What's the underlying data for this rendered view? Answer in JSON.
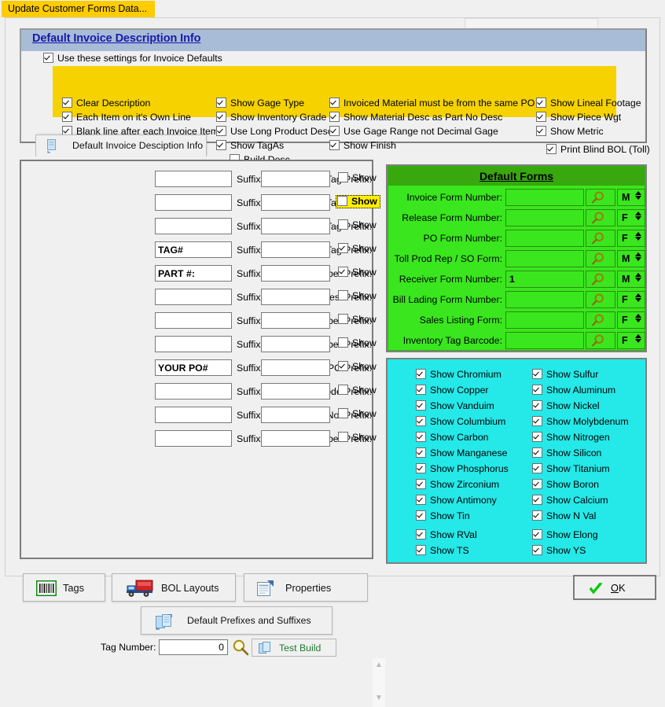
{
  "status_tab": {
    "label": "Update Customer Forms Data..."
  },
  "invoice_group": {
    "title": "Default Invoice Description Info",
    "use_settings": {
      "label": "Use these settings for Invoice Defaults",
      "checked": true
    },
    "tab_button": {
      "label": "Default Invoice Desciption Info",
      "icon": "document-copy-icon"
    },
    "col1": [
      {
        "label": "Clear Description",
        "checked": true
      },
      {
        "label": "Each Item on it's Own Line",
        "checked": true
      },
      {
        "label": "Blank line after each Invoice Item",
        "checked": true
      }
    ],
    "col2": [
      {
        "label": "Show Gage Type",
        "checked": true
      },
      {
        "label": "Show Inventory Grade",
        "checked": true
      },
      {
        "label": "Use Long Product Desc",
        "checked": true
      },
      {
        "label": "Show TagAs",
        "checked": true
      },
      {
        "label": "Build Desc",
        "checked": false
      }
    ],
    "col3": [
      {
        "label": "Invoiced Material must be from the same PO",
        "checked": true
      },
      {
        "label": "Show Material Desc as Part No Desc",
        "checked": true
      },
      {
        "label": "Use Gage Range not Decimal Gage",
        "checked": true
      },
      {
        "label": "Show Finish",
        "checked": true
      }
    ],
    "col4": [
      {
        "label": "Show Lineal Footage",
        "checked": true
      },
      {
        "label": "Show Piece Wgt",
        "checked": true
      },
      {
        "label": "Show Metric",
        "checked": true
      }
    ],
    "print_blind": {
      "label": "Print Blind BOL (Toll)",
      "checked": true
    }
  },
  "prefixes": {
    "suffix_label": "Suffix:",
    "show_label": "Show",
    "rows": [
      {
        "label": "Inventory Tag Prefix:",
        "prefix": "",
        "suffix": "",
        "show": false,
        "focused": false
      },
      {
        "label": "Mill Tag Prefix:",
        "prefix": "",
        "suffix": "",
        "show": false,
        "focused": true
      },
      {
        "label": "Processor Tag Prefix:",
        "prefix": "",
        "suffix": "",
        "show": false,
        "focused": false
      },
      {
        "label": "Storage Tag Prefix:",
        "prefix": "TAG#",
        "suffix": "",
        "show": true,
        "focused": false
      },
      {
        "label": "Part Number Prefix:",
        "prefix": "PART #:",
        "suffix": "",
        "show": true,
        "focused": false
      },
      {
        "label": "Part DescPrefix:",
        "prefix": "",
        "suffix": "",
        "show": false,
        "focused": false
      },
      {
        "label": "Heat Number Prefix:",
        "prefix": "",
        "suffix": "",
        "show": false,
        "focused": false
      },
      {
        "label": "Release Number Prefix:",
        "prefix": "",
        "suffix": "",
        "show": false,
        "focused": false
      },
      {
        "label": "Customer PO Prefix:",
        "prefix": "YOUR PO#",
        "suffix": "",
        "show": true,
        "focused": false
      },
      {
        "label": "Paint Code Prefix:",
        "prefix": "",
        "suffix": "",
        "show": false,
        "focused": false
      },
      {
        "label": "Sales Order No. Prefix:",
        "prefix": "",
        "suffix": "",
        "show": false,
        "focused": false
      },
      {
        "label": "BOL Number Prefix:",
        "prefix": "",
        "suffix": "",
        "show": false,
        "focused": false
      }
    ],
    "default_button": {
      "label": "Default Prefixes and Suffixes",
      "icon": "document-copy-icon"
    },
    "tag_number": {
      "label": "Tag Number:",
      "value": "0"
    },
    "magnifier_icon": "magnifier-icon",
    "test_build": {
      "label": "Test Build",
      "icon": "document-copy-icon"
    }
  },
  "default_forms": {
    "title": "Default Forms",
    "rows": [
      {
        "label": "Invoice Form Number:",
        "value": "",
        "mf": "M"
      },
      {
        "label": "Release Form Number:",
        "value": "",
        "mf": "F"
      },
      {
        "label": "PO Form Number:",
        "value": "",
        "mf": "F"
      },
      {
        "label": "Toll Prod Rep / SO Form:",
        "value": "",
        "mf": "M"
      },
      {
        "label": "Receiver Form Number:",
        "value": "1",
        "mf": "M"
      },
      {
        "label": "Bill Lading Form Number:",
        "value": "",
        "mf": "F"
      },
      {
        "label": "Sales Listing Form:",
        "value": "",
        "mf": "F"
      },
      {
        "label": "Inventory Tag Barcode:",
        "value": "",
        "mf": "F"
      }
    ]
  },
  "chemistry": {
    "left": [
      {
        "label": "Show Chromium",
        "checked": true
      },
      {
        "label": "Show Copper",
        "checked": true
      },
      {
        "label": "Show Vanduim",
        "checked": true
      },
      {
        "label": "Show Columbium",
        "checked": true
      },
      {
        "label": "Show Carbon",
        "checked": true
      },
      {
        "label": "Show Manganese",
        "checked": true
      },
      {
        "label": "Show Phosphorus",
        "checked": true
      },
      {
        "label": "Show Zirconium",
        "checked": true
      },
      {
        "label": "Show Antimony",
        "checked": true
      },
      {
        "label": "Show Tin",
        "checked": true
      },
      {
        "label": "Show RVal",
        "checked": true
      },
      {
        "label": "Show TS",
        "checked": true
      }
    ],
    "right": [
      {
        "label": "Show Sulfur",
        "checked": true
      },
      {
        "label": "Show Aluminum",
        "checked": true
      },
      {
        "label": "Show Nickel",
        "checked": true
      },
      {
        "label": "Show Molybdenum",
        "checked": true
      },
      {
        "label": "Show Nitrogen",
        "checked": true
      },
      {
        "label": "Show Silicon",
        "checked": true
      },
      {
        "label": "Show Titanium",
        "checked": true
      },
      {
        "label": "Show Boron",
        "checked": true
      },
      {
        "label": "Show Calcium",
        "checked": true
      },
      {
        "label": "Show N Val",
        "checked": true
      },
      {
        "label": "Show Elong",
        "checked": true
      },
      {
        "label": "Show YS",
        "checked": true
      }
    ]
  },
  "bottom": {
    "tags": {
      "label": "Tags",
      "icon": "barcode-icon"
    },
    "bol_layouts": {
      "label": "BOL Layouts",
      "icon": "truck-icon"
    },
    "properties": {
      "label": "Properties",
      "icon": "properties-icon"
    },
    "ok": {
      "label_pre": "",
      "label_accel": "O",
      "label_post": "K",
      "icon": "check-icon"
    }
  },
  "colors": {
    "status_tab": "#ffcc00",
    "yellow": "#f5d200",
    "title_band": "#a8bcd8",
    "title_text": "#1a1aa8",
    "green_body": "#3ae61e",
    "green_head": "#39a80e",
    "cyan": "#25e8e8",
    "focus_yellow": "#ffee00"
  }
}
